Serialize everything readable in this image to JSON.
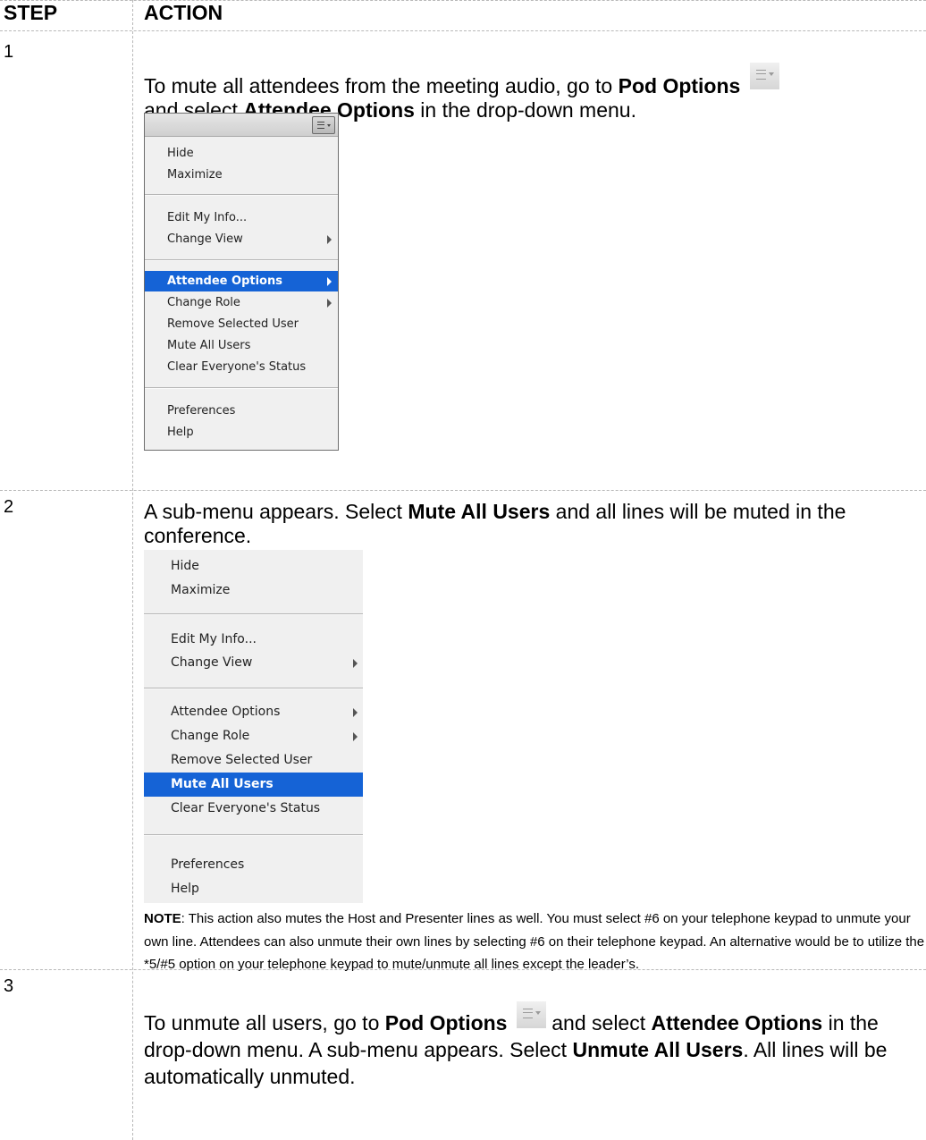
{
  "header": {
    "step": "STEP",
    "action": "ACTION"
  },
  "pod_icon": "pod-options-icon",
  "steps": [
    {
      "number": "1",
      "text": {
        "a": "To mute all attendees from the meeting audio, go to ",
        "b": "Pod Options",
        "c": "and select ",
        "d": "Attendee Options",
        "e": " in the drop-down menu."
      },
      "menu": {
        "items": [
          {
            "label": "Hide"
          },
          {
            "label": "Maximize"
          },
          {
            "label": "Edit My Info..."
          },
          {
            "label": "Change View",
            "submenu": true
          },
          {
            "label": "Attendee Options",
            "submenu": true,
            "selected": true
          },
          {
            "label": "Change Role",
            "submenu": true
          },
          {
            "label": "Remove Selected User"
          },
          {
            "label": "Mute All Users"
          },
          {
            "label": "Clear Everyone's Status"
          },
          {
            "label": "Preferences"
          },
          {
            "label": "Help"
          }
        ]
      }
    },
    {
      "number": "2",
      "text": {
        "a": "A sub-menu appears.  Select ",
        "b": "Mute All Users",
        "c": " and all lines will be muted in the conference."
      },
      "menu": {
        "items": [
          {
            "label": "Hide"
          },
          {
            "label": "Maximize"
          },
          {
            "label": "Edit My Info..."
          },
          {
            "label": "Change View",
            "submenu": true
          },
          {
            "label": "Attendee Options",
            "submenu": true
          },
          {
            "label": "Change Role",
            "submenu": true
          },
          {
            "label": "Remove Selected User"
          },
          {
            "label": "Mute All Users",
            "selected": true
          },
          {
            "label": "Clear Everyone's Status"
          },
          {
            "label": "Preferences"
          },
          {
            "label": "Help"
          }
        ]
      },
      "note": {
        "label": "NOTE",
        "text": ": This action also mutes the Host and Presenter lines as well.  You must select #6 on your telephone keypad to unmute your own line. Attendees can also unmute their own lines by selecting #6 on their telephone keypad.  An alternative would be to utilize the *5/#5 option on your telephone keypad to mute/unmute all lines except the leader’s."
      }
    },
    {
      "number": "3",
      "text": {
        "a": "To unmute all users, go to ",
        "b": "Pod Options",
        "c": " and select ",
        "d": "Attendee Options",
        "e": " in the drop-down menu.  A sub-menu appears.  Select ",
        "f": "Unmute All Users",
        "g": ".  All lines will be automatically unmuted."
      }
    }
  ]
}
